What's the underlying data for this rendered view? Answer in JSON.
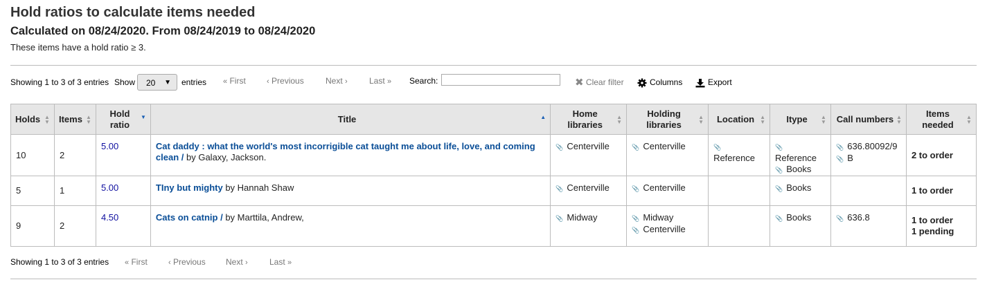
{
  "page": {
    "title": "Hold ratios to calculate items needed",
    "subtitle": "Calculated on 08/24/2020. From 08/24/2019 to 08/24/2020",
    "note": "These items have a hold ratio ≥ 3."
  },
  "toolbar": {
    "info": "Showing 1 to 3 of 3 entries",
    "show_label": "Show",
    "page_size": "20",
    "entries_label": "entries",
    "first": "First",
    "previous": "Previous",
    "next": "Next",
    "last": "Last",
    "search_label": "Search:",
    "search_value": "",
    "clear_filter": "Clear filter",
    "columns": "Columns",
    "export": "Export"
  },
  "columns": {
    "holds": "Holds",
    "items": "Items",
    "hold_ratio_1": "Hold",
    "hold_ratio_2": "ratio",
    "title": "Title",
    "home_1": "Home",
    "home_2": "libraries",
    "holding_1": "Holding",
    "holding_2": "libraries",
    "location": "Location",
    "itype": "Itype",
    "call_numbers": "Call numbers",
    "needed_1": "Items",
    "needed_2": "needed"
  },
  "rows": [
    {
      "holds": "10",
      "items": "2",
      "ratio": "5.00",
      "title": "Cat daddy : what the world's most incorrigible cat taught me about life, love, and coming clean /",
      "author": " by Galaxy, Jackson.",
      "home": [
        "Centerville"
      ],
      "holding": [
        "Centerville"
      ],
      "location": [
        "Reference"
      ],
      "itype": [
        "Reference",
        "Books"
      ],
      "callnumbers": [
        "636.80092/9",
        "B"
      ],
      "needed": [
        "2 to order"
      ]
    },
    {
      "holds": "5",
      "items": "1",
      "ratio": "5.00",
      "title": "TIny but mighty",
      "author": " by Hannah Shaw",
      "home": [
        "Centerville"
      ],
      "holding": [
        "Centerville"
      ],
      "location": [],
      "itype": [
        "Books"
      ],
      "callnumbers": [],
      "needed": [
        "1 to order"
      ]
    },
    {
      "holds": "9",
      "items": "2",
      "ratio": "4.50",
      "title": "Cats on catnip /",
      "author": " by Marttila, Andrew,",
      "home": [
        "Midway"
      ],
      "holding": [
        "Midway",
        "Centerville"
      ],
      "location": [],
      "itype": [
        "Books"
      ],
      "callnumbers": [
        "636.8"
      ],
      "needed": [
        "1 to order",
        "1 pending"
      ]
    }
  ],
  "footer": {
    "info": "Showing 1 to 3 of 3 entries",
    "first": "First",
    "previous": "Previous",
    "next": "Next",
    "last": "Last"
  }
}
